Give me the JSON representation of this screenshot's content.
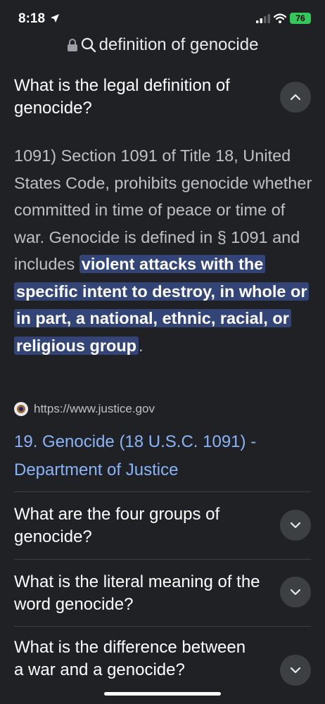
{
  "status_bar": {
    "time": "8:18",
    "battery": "76"
  },
  "url_bar": {
    "text": "definition of genocide"
  },
  "expanded_question": {
    "title": "What is the legal definition of genocide?",
    "answer_before": "1091) Section 1091 of Title 18, United States Code, prohibits genocide whether committed in time of peace or time of war. Genocide is defined in § 1091 and includes ",
    "answer_highlight": "violent attacks with the specific intent to destroy, in whole or in part, a national, ethnic, racial, or religious group",
    "answer_after": ".",
    "source_url": "https://www.justice.gov",
    "source_title": "19. Genocide (18 U.S.C. 1091) - Department of Justice"
  },
  "questions": [
    "What are the four groups of genocide?",
    "What is the literal meaning of the word genocide?",
    "What is the difference between a war and a genocide?"
  ],
  "colors": {
    "background": "#202124",
    "highlight": "#334476",
    "link": "#8ab4f8",
    "battery": "#34c759"
  }
}
